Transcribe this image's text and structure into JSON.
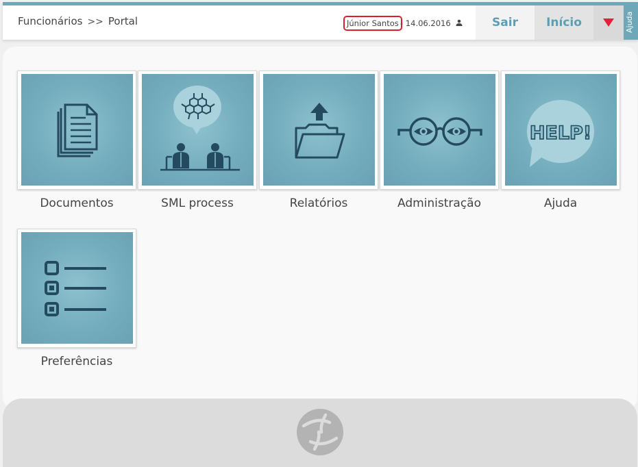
{
  "header": {
    "breadcrumb": [
      "Funcionários",
      "Portal"
    ],
    "separator": ">>",
    "user_name": "Júnior Santos",
    "date_text": "- 14.06.2016",
    "sair_label": "Sair",
    "inicio_label": "Início",
    "help_tab_label": "Ajuda"
  },
  "tiles": [
    {
      "label": "Documentos",
      "icon": "documents-icon"
    },
    {
      "label": "SML process",
      "icon": "sml-process-icon"
    },
    {
      "label": "Relatórios",
      "icon": "folder-upload-icon"
    },
    {
      "label": "Administração",
      "icon": "glasses-icon"
    },
    {
      "label": "Ajuda",
      "icon": "help-bubble-icon"
    },
    {
      "label": "Preferências",
      "icon": "checklist-icon"
    }
  ],
  "help_bubble_text": "HELP!",
  "colors": {
    "accent": "#6ea7b8",
    "tile_face": "#74adbe",
    "icon_dark": "#234a5e",
    "button_text": "#5c9fb5",
    "dropdown_arrow": "#e0213b",
    "user_highlight": "#d8202a"
  }
}
